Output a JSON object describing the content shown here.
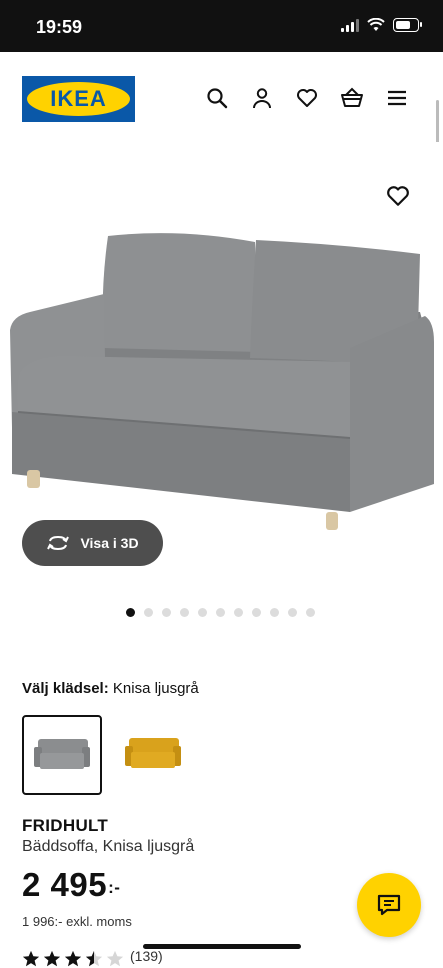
{
  "status": {
    "time": "19:59",
    "battery_level": 0.75
  },
  "header": {
    "logo_text": "IKEA",
    "icons": [
      "search-icon",
      "user-icon",
      "heart-icon",
      "basket-icon",
      "menu-icon"
    ]
  },
  "gallery": {
    "view_3d_label": "Visa i 3D",
    "dot_count": 11,
    "active_dot": 0
  },
  "product": {
    "fabric_label": "Välj klädsel:",
    "fabric_value": "Knisa ljusgrå",
    "swatches": [
      "light-grey",
      "yellow"
    ],
    "name": "FRIDHULT",
    "description": "Bäddsoffa, Knisa ljusgrå",
    "price": "2 495",
    "price_suffix": ":-",
    "price_ex_vat": "1 996:- exkl. moms",
    "rating_stars": 3.5,
    "rating_count": "(139)"
  },
  "colors": {
    "ikea_blue": "#0a58a8",
    "ikea_yellow": "#ffd200",
    "sofa_grey": "#8b8d8f",
    "sofa_yellow": "#d9a21c"
  }
}
